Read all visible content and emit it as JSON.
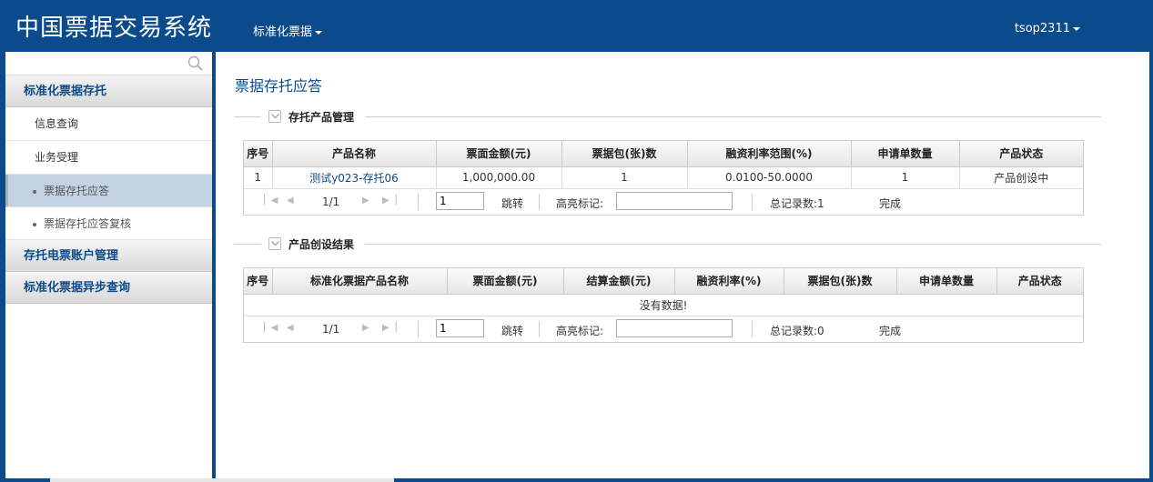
{
  "app": {
    "title": "中国票据交易系统",
    "menu_label": "标准化票据",
    "user": "tsop2311"
  },
  "sidebar": {
    "groups": [
      {
        "label": "标准化票据存托"
      },
      {
        "label": "存托电票账户管理"
      },
      {
        "label": "标准化票据异步查询"
      }
    ],
    "items": [
      {
        "label": "信息查询"
      },
      {
        "label": "业务受理"
      }
    ],
    "subitems": [
      {
        "label": "票据存托应答",
        "active": true
      },
      {
        "label": "票据存托应答复核",
        "active": false
      }
    ]
  },
  "page": {
    "title": "票据存托应答"
  },
  "section1": {
    "title": "存托产品管理",
    "columns": [
      "序号",
      "产品名称",
      "票面金额(元)",
      "票据包(张)数",
      "融资利率范围(%)",
      "申请单数量",
      "产品状态"
    ],
    "rows": [
      [
        "1",
        "测试y023-存托06",
        "1,000,000.00",
        "1",
        "0.0100-50.0000",
        "1",
        "产品创设中"
      ]
    ],
    "pager": {
      "page": "1/1",
      "page_input": "1",
      "jump": "跳转",
      "highlight": "高亮标记:",
      "total": "总记录数:1",
      "status": "完成"
    }
  },
  "section2": {
    "title": "产品创设结果",
    "columns": [
      "序号",
      "标准化票据产品名称",
      "票面金额(元)",
      "结算金额(元)",
      "融资利率(%)",
      "票据包(张)数",
      "申请单数量",
      "产品状态"
    ],
    "empty_text": "没有数据!",
    "pager": {
      "page": "1/1",
      "page_input": "1",
      "jump": "跳转",
      "highlight": "高亮标记:",
      "total": "总记录数:0",
      "status": "完成"
    }
  },
  "colors": {
    "brand": "#0b4a8b",
    "link": "#0b4a8b",
    "active_item": "#c3d3e3"
  }
}
